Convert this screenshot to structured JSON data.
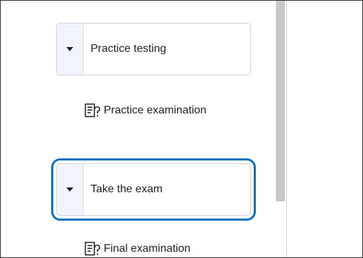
{
  "sidebar": {
    "modules": [
      {
        "label": "Practice testing",
        "expanded": true,
        "focused": false
      },
      {
        "label": "Take the exam",
        "expanded": true,
        "focused": true
      }
    ],
    "topics": [
      {
        "label": "Practice examination",
        "icon": "quiz-icon"
      },
      {
        "label": "Final examination",
        "icon": "quiz-icon"
      }
    ]
  },
  "colors": {
    "focus_ring": "#006fbf",
    "toggle_bg": "#f1f5fb",
    "border": "#cdd3dc",
    "text": "#202122"
  }
}
